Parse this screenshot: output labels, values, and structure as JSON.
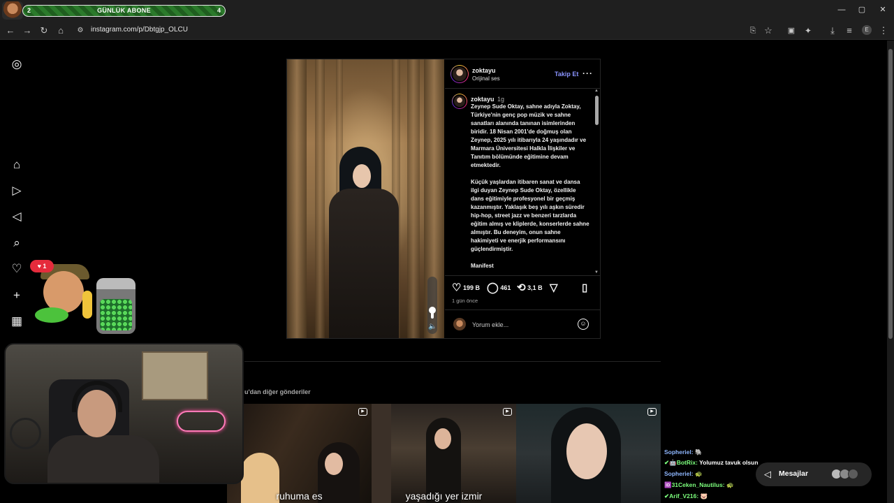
{
  "browser": {
    "url": "instagram.com/p/Dbtgjp_OLCU",
    "window_controls": [
      "—",
      "▢",
      "✕"
    ]
  },
  "goal": {
    "title": "GÜNLÜK ABONE",
    "current": "2",
    "target": "4"
  },
  "post": {
    "author": "zoktayu",
    "audio": "Orijinal ses",
    "follow_label": "Takip Et",
    "more_label": "···",
    "caption_author": "zoktayu",
    "caption_time": "1g",
    "caption_paragraphs": [
      "Zeynep Sude Oktay, sahne adıyla Zoktay, Türkiye'nin genç pop müzik ve sahne sanatları alanında tanınan isimlerinden biridir. 18 Nisan 2001'de doğmuş olan Zeynep, 2025 yılı itibarıyla 24 yaşındadır ve Marmara Üniversitesi Halkla İlişkiler ve Tanıtım bölümünde eğitimine devam etmektedir.",
      "Küçük yaşlardan itibaren sanat ve dansa ilgi duyan Zeynep Sude Oktay, özellikle dans eğitimiyle profesyonel bir geçmiş kazanmıştır. Yaklaşık beş yılı aşkın süredir hip-hop, street jazz ve benzeri tarzlarda eğitim almış ve kliplerde, konserlerde sahne almıştır. Bu deneyim, onun sahne hakimiyeti ve enerjik performansını güçlendirmiştir.",
      "Manifest"
    ],
    "likes": "199 B",
    "comments": "461",
    "reposts": "3,1 B",
    "posted_ago": "1 gün önce",
    "comment_placeholder": "Yorum ekle...",
    "icons": {
      "like": "heart-icon",
      "comment": "comment-icon",
      "repost": "repost-icon",
      "share": "share-icon",
      "save": "bookmark-icon",
      "emoji": "emoji-icon"
    }
  },
  "more_posts": {
    "title_suffix": "u'dan diğer gönderiler",
    "items": [
      {
        "caption": "ruhuma es"
      },
      {
        "caption": "yaşadığı yer izmir"
      },
      {
        "caption": ""
      }
    ]
  },
  "like_badge": "1",
  "chat": [
    {
      "user": "Sopheriel:",
      "message": "🐘",
      "color": "blue"
    },
    {
      "user": "✔🤖BotRix:",
      "message": "Yolumuz tavuk olsun",
      "color": "green"
    },
    {
      "user": "Sopheriel:",
      "message": "🐢",
      "color": "blue"
    },
    {
      "user": "🆔31Ceken_Nautilus:",
      "message": "🐢",
      "color": "green"
    },
    {
      "user": "✔Arif_V216:",
      "message": "🐷",
      "color": "green"
    }
  ],
  "messages_button": "Mesajlar",
  "colors": {
    "accent_follow": "#8a94ff",
    "like_badge": "#e52b3c",
    "background": "#000000"
  }
}
